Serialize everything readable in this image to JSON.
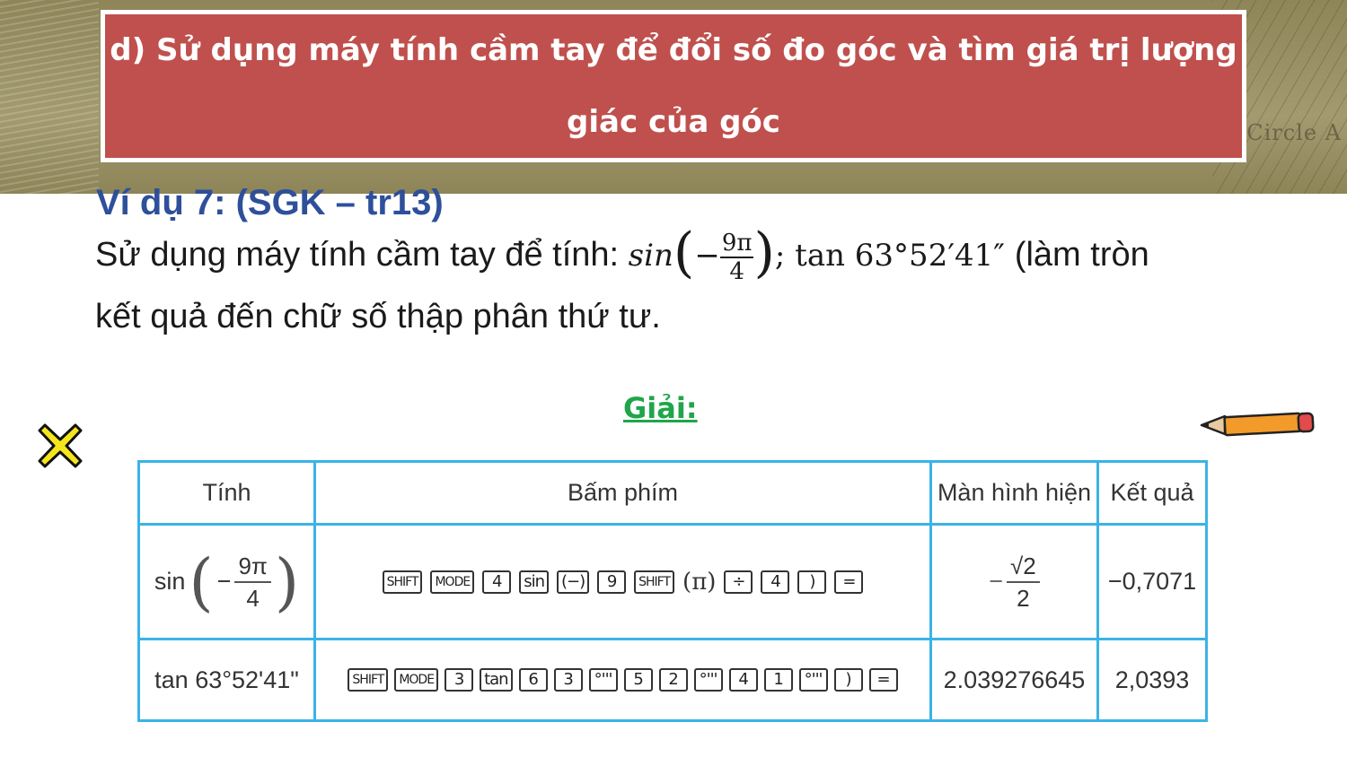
{
  "header": {
    "title_line1": "d) Sử dụng máy tính cầm tay để đổi số đo góc và tìm giá trị lượng",
    "title_line2": "giác của góc",
    "bg_text": "Circle A"
  },
  "example": {
    "label": "Ví dụ 7: (SGK – tr13)",
    "intro": "Sử dụng máy tính cầm tay để tính:",
    "math_sin": "sin",
    "math_num": "9π",
    "math_den": "4",
    "math_sep": ";",
    "math_tan": "tan 63°52′41″",
    "tail": "(làm tròn",
    "line2": "kết quả đến chữ số thập phân thứ tư."
  },
  "solution": {
    "label": "Giải:"
  },
  "icons": {
    "left": "x-mark-icon",
    "right": "pencil-icon"
  },
  "table": {
    "headers": [
      "Tính",
      "Bấm phím",
      "Màn hình hiện",
      "Kết quả"
    ],
    "row1": {
      "expr_func": "sin",
      "expr_minus": "−",
      "expr_num": "9π",
      "expr_den": "4",
      "keys": [
        "SHIFT",
        "MODE",
        "4",
        "sin",
        "(−)",
        "9",
        "SHIFT",
        "(π)",
        "÷",
        "4",
        ")",
        "="
      ],
      "screen_minus": "−",
      "screen_num": "√2",
      "screen_den": "2",
      "result": "−0,7071"
    },
    "row2": {
      "expr": "tan 63°52'41\"",
      "keys": [
        "SHIFT",
        "MODE",
        "3",
        "tan",
        "6",
        "3",
        "°'''",
        "5",
        "2",
        "°'''",
        "4",
        "1",
        "°'''",
        ")",
        "="
      ],
      "screen": "2.039276645",
      "result": "2,0393"
    }
  },
  "colors": {
    "title_bg": "#c0504d",
    "example_label": "#2e4f9a",
    "solution_label": "#1fa64a",
    "table_border": "#3bb3e6"
  }
}
